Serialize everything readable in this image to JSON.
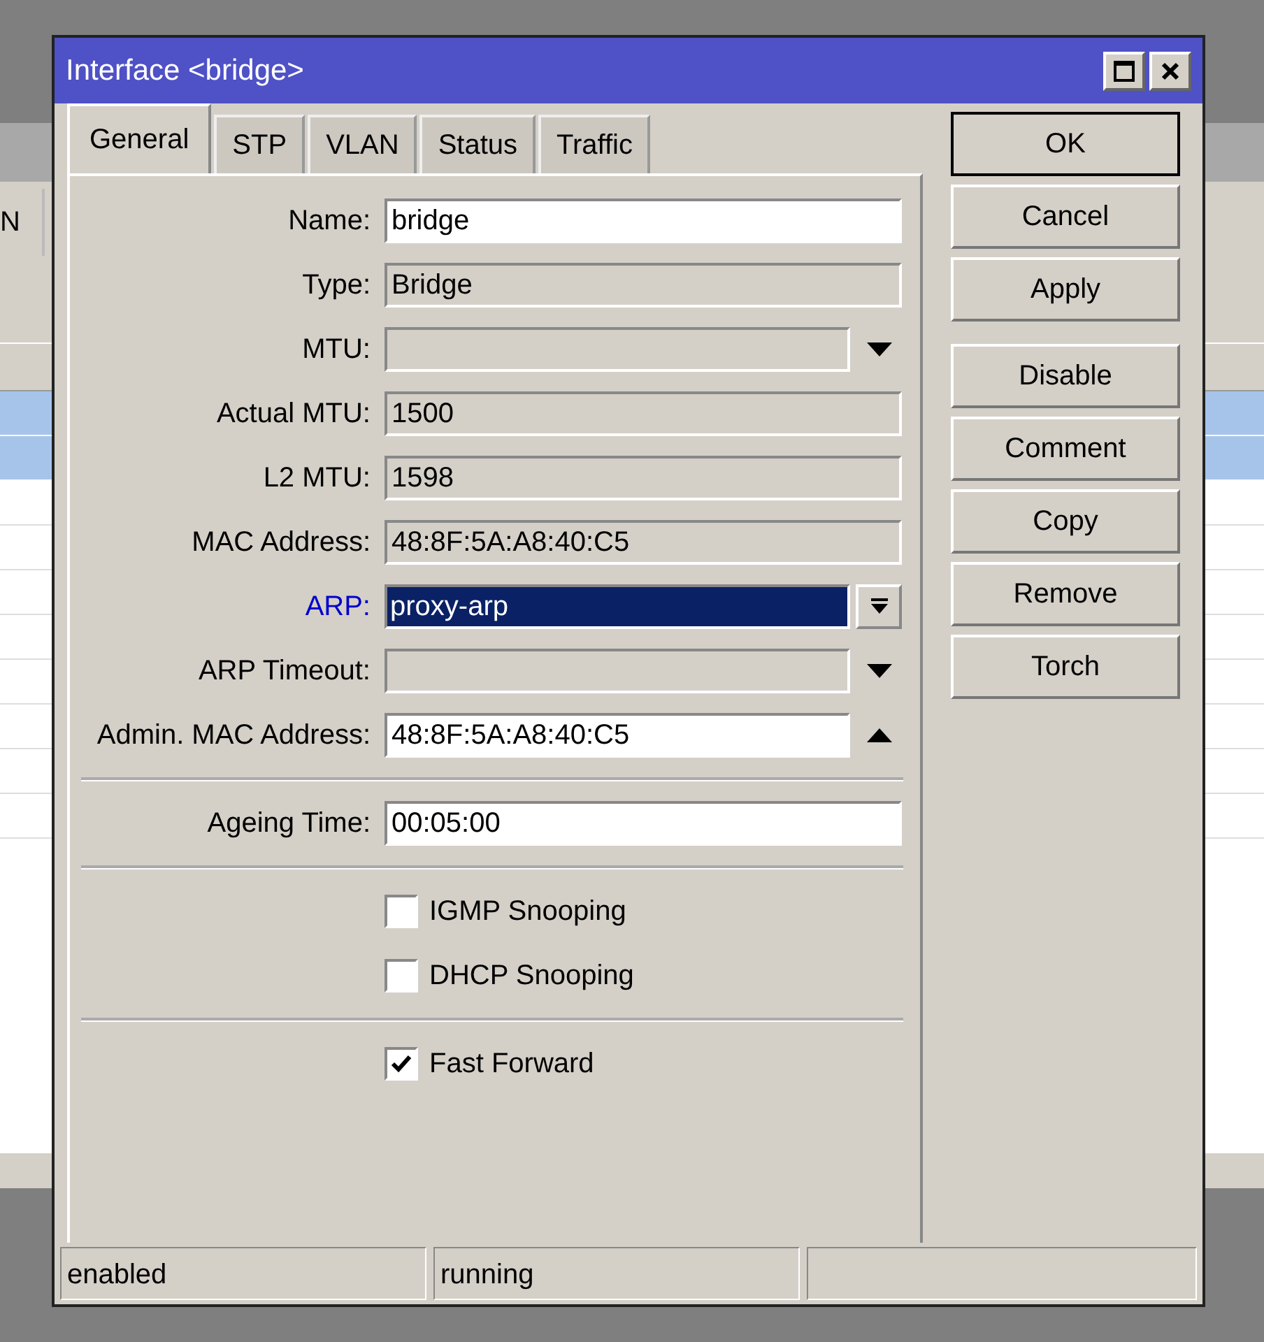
{
  "background_window": {
    "column_header": "N",
    "rows": [
      {
        "selected": true
      },
      {
        "selected": true
      },
      {
        "selected": false
      },
      {
        "selected": false
      },
      {
        "selected": false
      },
      {
        "selected": false
      },
      {
        "selected": false
      },
      {
        "selected": false
      },
      {
        "selected": false
      },
      {
        "selected": false
      }
    ]
  },
  "window": {
    "title": "Interface <bridge>"
  },
  "tabs": [
    {
      "label": "General",
      "selected": true
    },
    {
      "label": "STP",
      "selected": false
    },
    {
      "label": "VLAN",
      "selected": false
    },
    {
      "label": "Status",
      "selected": false
    },
    {
      "label": "Traffic",
      "selected": false
    }
  ],
  "sections": [
    {
      "items": [
        {
          "kind": "text",
          "label": "Name:",
          "value": "bridge",
          "changed": false
        },
        {
          "kind": "readonly",
          "label": "Type:",
          "value": "Bridge",
          "changed": false
        },
        {
          "kind": "dropdown",
          "label": "MTU:",
          "changed": false
        },
        {
          "kind": "readonly",
          "label": "Actual MTU:",
          "value": "1500",
          "changed": false
        },
        {
          "kind": "readonly",
          "label": "L2 MTU:",
          "value": "1598",
          "changed": false
        },
        {
          "kind": "readonly",
          "label": "MAC Address:",
          "value": "48:8F:5A:A8:40:C5",
          "changed": false
        },
        {
          "kind": "select",
          "label": "ARP:",
          "value": "proxy-arp",
          "changed": true,
          "selected": true
        },
        {
          "kind": "dropdown",
          "label": "ARP Timeout:",
          "changed": false
        },
        {
          "kind": "expandable",
          "label": "Admin. MAC Address:",
          "value": "48:8F:5A:A8:40:C5",
          "changed": false
        }
      ]
    },
    {
      "items": [
        {
          "kind": "text",
          "label": "Ageing Time:",
          "value": "00:05:00",
          "changed": false
        }
      ]
    },
    {
      "items": [
        {
          "kind": "checkbox",
          "label": "IGMP Snooping",
          "checked": false
        },
        {
          "kind": "checkbox",
          "label": "DHCP Snooping",
          "checked": false
        }
      ]
    },
    {
      "items": [
        {
          "kind": "checkbox",
          "label": "Fast Forward",
          "checked": true
        }
      ]
    }
  ],
  "buttons": [
    {
      "label": "OK",
      "default": true
    },
    {
      "label": "Cancel",
      "default": false
    },
    {
      "label": "Apply",
      "default": false
    },
    {
      "label": "Disable",
      "default": false
    },
    {
      "label": "Comment",
      "default": false
    },
    {
      "label": "Copy",
      "default": false
    },
    {
      "label": "Remove",
      "default": false
    },
    {
      "label": "Torch",
      "default": false
    }
  ],
  "status_bar": [
    "enabled",
    "running"
  ]
}
